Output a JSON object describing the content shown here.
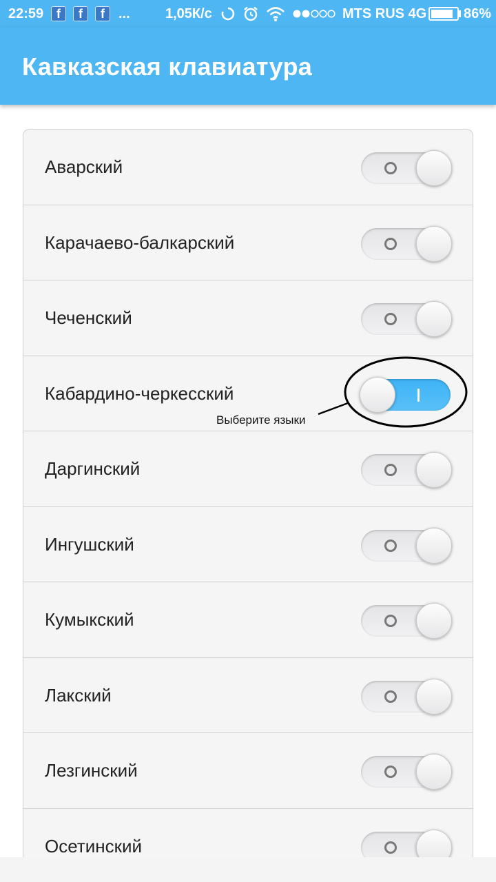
{
  "status_bar": {
    "time": "22:59",
    "fb_glyph": "f",
    "more": "...",
    "speed": "1,05К/с",
    "carrier": "MTS RUS 4G",
    "battery_level": 0.86,
    "battery_label": "86%",
    "icons": [
      "facebook-icon",
      "facebook-icon",
      "facebook-icon",
      "sync-icon",
      "alarm-icon",
      "wifi-icon",
      "signal-dots-icon",
      "battery-icon"
    ]
  },
  "app_bar": {
    "title": "Кавказская клавиатура"
  },
  "languages": [
    {
      "label": "Аварский",
      "enabled": false
    },
    {
      "label": "Карачаево-балкарский",
      "enabled": false
    },
    {
      "label": "Чеченский",
      "enabled": false
    },
    {
      "label": "Кабардино-черкесский",
      "enabled": true
    },
    {
      "label": "Даргинский",
      "enabled": false
    },
    {
      "label": "Ингушский",
      "enabled": false
    },
    {
      "label": "Кумыкский",
      "enabled": false
    },
    {
      "label": "Лакский",
      "enabled": false
    },
    {
      "label": "Лезгинский",
      "enabled": false
    },
    {
      "label": "Осетинский",
      "enabled": false
    }
  ],
  "annotation": {
    "text": "Выберите языки"
  },
  "colors": {
    "accent": "#4db6f3",
    "switch_on": "#3fb3f6",
    "card_bg": "#f5f5f5"
  }
}
